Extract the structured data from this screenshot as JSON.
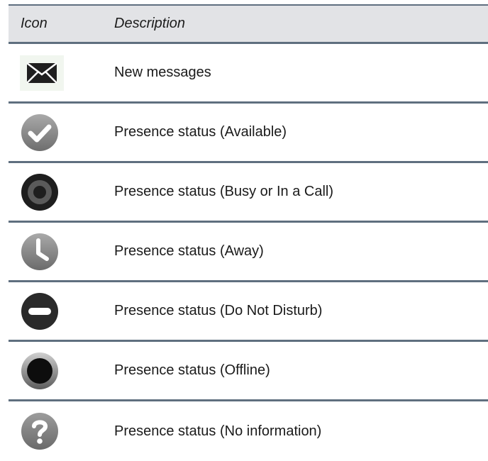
{
  "table": {
    "header": {
      "icon_col": "Icon",
      "description_col": "Description"
    },
    "rows": [
      {
        "icon": "envelope-icon",
        "description": "New messages"
      },
      {
        "icon": "checkmark-circle-icon",
        "description": "Presence status (Available)"
      },
      {
        "icon": "busy-ring-icon",
        "description": "Presence status (Busy or In a Call)"
      },
      {
        "icon": "clock-icon",
        "description": "Presence status (Away)"
      },
      {
        "icon": "minus-circle-icon",
        "description": "Presence status (Do Not Disturb)"
      },
      {
        "icon": "offline-circle-icon",
        "description": "Presence status (Offline)"
      },
      {
        "icon": "question-circle-icon",
        "description": "Presence status (No information)"
      }
    ]
  },
  "colors": {
    "header_bg": "#e2e3e6",
    "rule": "#5f6f7f",
    "icon_gray": "#8a8a8a",
    "icon_dark": "#2b2b2b"
  }
}
